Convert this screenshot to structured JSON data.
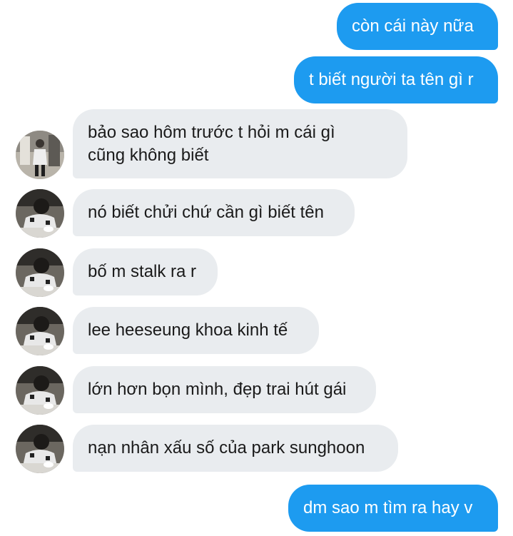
{
  "conversation": {
    "messages": [
      {
        "direction": "out",
        "text": "còn cái này nữa"
      },
      {
        "direction": "out",
        "text": "t biết người ta tên gì r"
      },
      {
        "direction": "in",
        "lines": [
          "bảo sao hôm trước t hỏi m cái gì",
          "cũng không biết"
        ]
      },
      {
        "direction": "in",
        "text": "nó biết chửi chứ cần gì biết tên"
      },
      {
        "direction": "in",
        "text": "bố m stalk ra r"
      },
      {
        "direction": "in",
        "text": "lee heeseung khoa kinh tế"
      },
      {
        "direction": "in",
        "text": "lớn hơn bọn mình, đẹp trai hút gái"
      },
      {
        "direction": "in",
        "text": "nạn nhân xấu số của park sunghoon"
      },
      {
        "direction": "out",
        "text": "dm sao m tìm ra hay v"
      }
    ]
  },
  "colors": {
    "outgoing_bubble": "#1d9bf0",
    "incoming_bubble": "#e9ecef",
    "incoming_text": "#1a1a1a",
    "outgoing_text": "#ffffff"
  },
  "icons": {
    "avatar_standing": "profile-photo-standing-person",
    "avatar_cafe": "profile-photo-person-at-cafe"
  }
}
